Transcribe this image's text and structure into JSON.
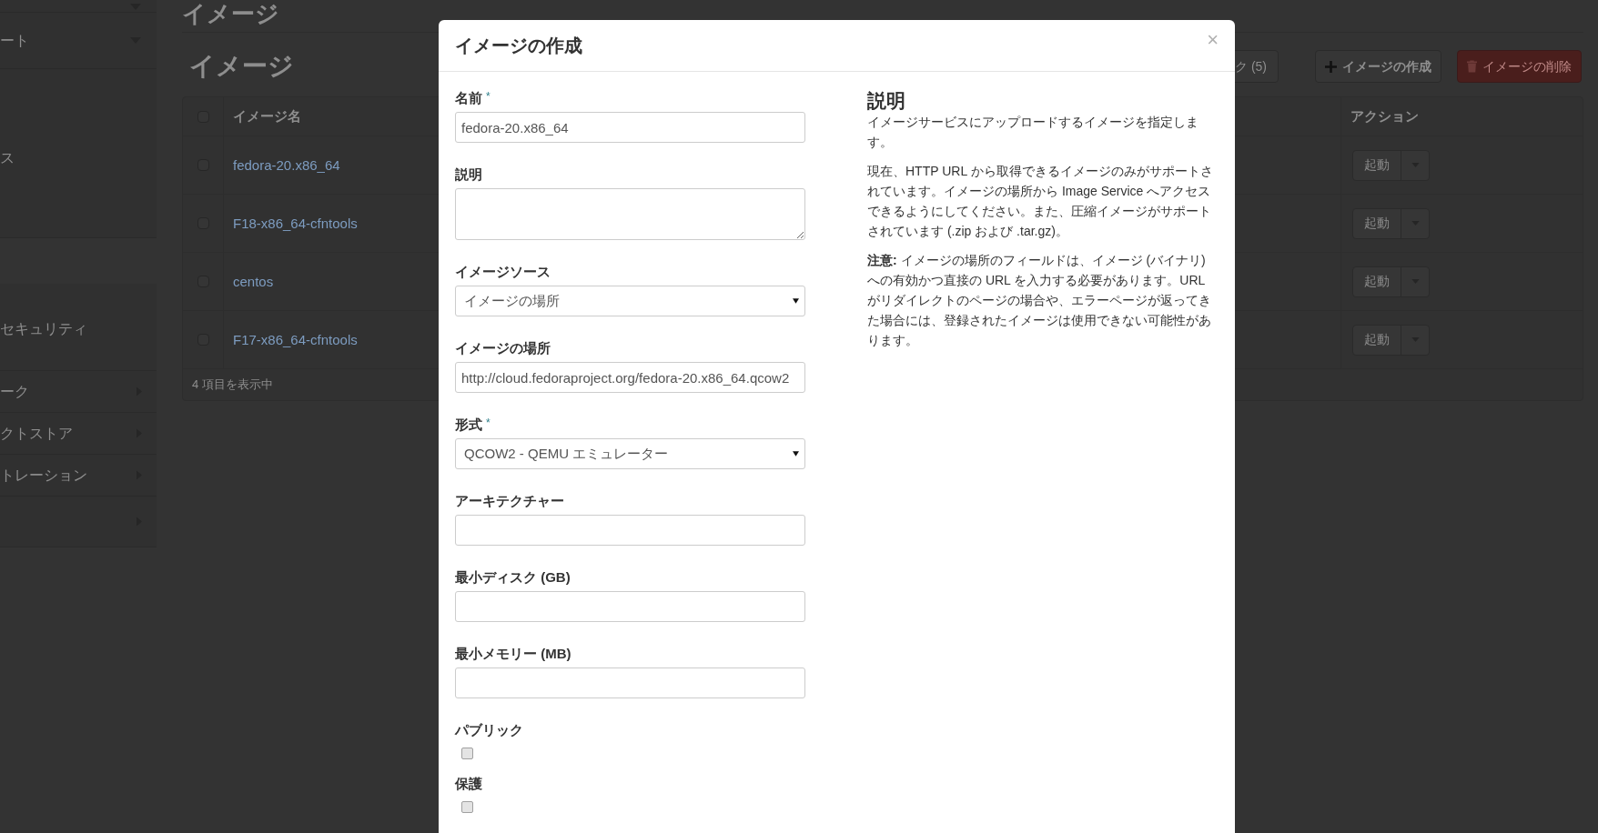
{
  "page": {
    "title": "イメージ",
    "subtitle": "イメージ"
  },
  "sidebar": {
    "items": [
      {
        "kind": "dropdown"
      },
      {
        "kind": "dropdown",
        "label": "ート"
      },
      {
        "kind": "plain",
        "label": "ス"
      },
      {
        "kind": "plain",
        "label": "セキュリティ"
      },
      {
        "kind": "submenu",
        "label": "ーク"
      },
      {
        "kind": "submenu",
        "label": "クトストア"
      },
      {
        "kind": "submenu",
        "label": "トレーション"
      },
      {
        "kind": "submenu"
      }
    ]
  },
  "toolbar": {
    "partial_button": "ク (5)",
    "create_button": "イメージの作成",
    "delete_button": "イメージの削除"
  },
  "table": {
    "columns": [
      "イメージ名",
      "アクション"
    ],
    "all_checked": false,
    "rows": [
      {
        "name": "fedora-20.x86_64",
        "checked": false,
        "action": "起動"
      },
      {
        "name": "F18-x86_64-cfntools",
        "checked": false,
        "action": "起動"
      },
      {
        "name": "centos",
        "checked": false,
        "action": "起動"
      },
      {
        "name": "F17-x86_64-cfntools",
        "checked": false,
        "action": "起動"
      }
    ],
    "footer": "4 項目を表示中"
  },
  "modal": {
    "title": "イメージの作成",
    "close": "×",
    "fields": [
      {
        "kind": "text",
        "label": "名前",
        "required_mark": "*",
        "value": "fedora-20.x86_64"
      },
      {
        "kind": "textarea",
        "label": "説明"
      },
      {
        "kind": "select",
        "label": "イメージソース",
        "value": "イメージの場所"
      },
      {
        "kind": "text",
        "label": "イメージの場所",
        "value": "http://cloud.fedoraproject.org/fedora-20.x86_64.qcow2"
      },
      {
        "kind": "select",
        "label": "形式",
        "required_mark": "*",
        "value": "QCOW2 - QEMU エミュレーター"
      },
      {
        "kind": "text",
        "label": "アーキテクチャー"
      },
      {
        "kind": "text",
        "label": "最小ディスク (GB)"
      },
      {
        "kind": "text",
        "label": "最小メモリー (MB)"
      },
      {
        "kind": "checkbox",
        "label": "パブリック",
        "checked": false
      },
      {
        "kind": "checkbox",
        "label": "保護",
        "checked": false
      }
    ],
    "help": {
      "title": "説明",
      "paragraphs": [
        "イメージサービスにアップロードするイメージを指定します。",
        "現在、HTTP URL から取得できるイメージのみがサポートされています。イメージの場所から Image Service へアクセスできるようにしてください。また、圧縮イメージがサポートされています (.zip および .tar.gz)。",
        "**注意:** イメージの場所のフィールドは、イメージ (バイナリ) への有効かつ直接の URL を入力する必要があります。URL がリダイレクトのページの場合や、エラーページが返ってきた場合には、登録されたイメージは使用できない可能性があります。"
      ]
    }
  }
}
